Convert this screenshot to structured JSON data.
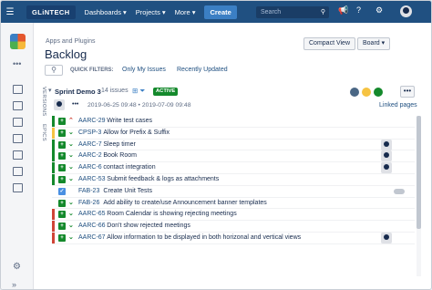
{
  "nav": {
    "logo": "GLiNTECH",
    "items": [
      "Dashboards",
      "Projects",
      "More"
    ],
    "create_label": "Create",
    "search_placeholder": "Search"
  },
  "sidebar": {
    "tabs": [
      "VERSIONS",
      "EPICS"
    ]
  },
  "header": {
    "breadcrumb": "Apps and Plugins",
    "title": "Backlog",
    "compact_view_label": "Compact View",
    "board_label": "Board"
  },
  "quick_filters": {
    "label": "QUICK FILTERS:",
    "items": [
      "Only My Issues",
      "Recently Updated"
    ]
  },
  "sprint": {
    "name": "Sprint Demo 3",
    "count": "14 issues",
    "status": "ACTIVE",
    "dates": "2019-06-25 09:48 • 2019-07-09 09:48",
    "linked_pages": "Linked pages",
    "dot_colors": [
      "#4a6785",
      "#f6c342",
      "#14892c"
    ]
  },
  "issues": [
    {
      "key": "AARC-29",
      "summary": "Write test cases",
      "type": "story",
      "priority": "up",
      "bar_color": "#14892c",
      "assignee": false
    },
    {
      "key": "CPSP-3",
      "summary": "Allow for Prefix & Suffix",
      "type": "story",
      "priority": "down",
      "bar_color": "#f6c342",
      "assignee": false
    },
    {
      "key": "AARC-7",
      "summary": "Sleep timer",
      "type": "story",
      "priority": "down",
      "bar_color": "#14892c",
      "assignee": true
    },
    {
      "key": "AARC-2",
      "summary": "Book Room",
      "type": "story",
      "priority": "down",
      "bar_color": "#14892c",
      "assignee": true
    },
    {
      "key": "AARC-6",
      "summary": "contact integration",
      "type": "story",
      "priority": "down",
      "bar_color": "#14892c",
      "assignee": true
    },
    {
      "key": "AARC-53",
      "summary": "Submit feedback & logs as attachments",
      "type": "story",
      "priority": "down",
      "bar_color": "#14892c",
      "assignee": false
    },
    {
      "key": "FAB-23",
      "summary": "Create Unit Tests",
      "type": "task",
      "priority": "none",
      "bar_color": "#ffffff",
      "assignee": false,
      "pill": true
    },
    {
      "key": "FAB-26",
      "summary": "Add ability to create/use Announcement banner templates",
      "type": "story",
      "priority": "down",
      "bar_color": "#ffffff",
      "assignee": false
    },
    {
      "key": "AARC-65",
      "summary": "Room Calendar is showing rejecting meetings",
      "type": "story",
      "priority": "down",
      "bar_color": "#d04437",
      "assignee": false
    },
    {
      "key": "AARC-66",
      "summary": "Don't show rejected meetings",
      "type": "story",
      "priority": "down",
      "bar_color": "#d04437",
      "assignee": false
    },
    {
      "key": "AARC-67",
      "summary": "Allow information to be displayed in both horizonal and vertical views",
      "type": "story",
      "priority": "down",
      "bar_color": "#d04437",
      "assignee": true
    }
  ],
  "colors": {
    "nav": "#205081",
    "story": "#14892c",
    "task": "#4a90e2",
    "priority_up": "#d04437",
    "priority_down": "#14892c",
    "link": "#205081"
  }
}
